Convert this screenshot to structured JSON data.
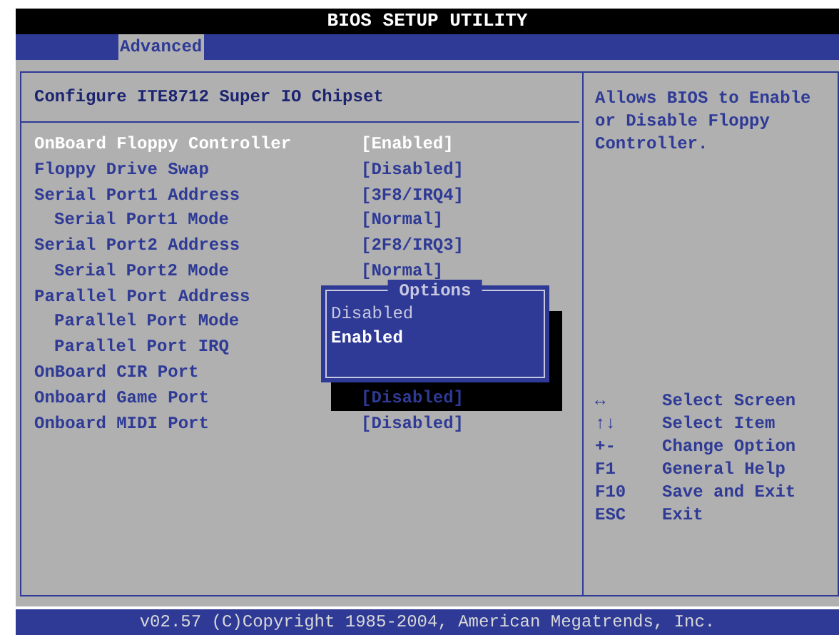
{
  "title": "BIOS SETUP UTILITY",
  "tabs": [
    {
      "label": "Advanced",
      "selected": true
    }
  ],
  "section_title": "Configure ITE8712 Super IO Chipset",
  "items": [
    {
      "label": "OnBoard Floppy Controller",
      "value": "[Enabled]",
      "selected": true
    },
    {
      "label": "Floppy Drive Swap",
      "value": "[Disabled]",
      "selected": false
    },
    {
      "label": "Serial Port1 Address",
      "value": "[3F8/IRQ4]",
      "selected": false,
      "children": [
        {
          "label": "Serial Port1 Mode",
          "value": "[Normal]",
          "selected": false
        }
      ]
    },
    {
      "label": "Serial Port2 Address",
      "value": "[2F8/IRQ3]",
      "selected": false,
      "children": [
        {
          "label": "Serial Port2 Mode",
          "value": "[Normal]",
          "selected": false
        }
      ]
    },
    {
      "label": "Parallel Port Address",
      "selected": false,
      "children": [
        {
          "label": "Parallel Port Mode",
          "selected": false
        },
        {
          "label": "Parallel Port IRQ",
          "selected": false
        }
      ]
    },
    {
      "label": "OnBoard CIR Port",
      "selected": false
    },
    {
      "label": "Onboard Game Port",
      "value": "[Disabled]",
      "selected": false
    },
    {
      "label": "Onboard MIDI Port",
      "value": "[Disabled]",
      "selected": false
    }
  ],
  "help_text": "Allows BIOS to Enable or Disable Floppy Controller.",
  "keys": [
    {
      "key": "↔",
      "action": "Select Screen"
    },
    {
      "key": "↑↓",
      "action": "Select Item"
    },
    {
      "key": "+-",
      "action": "Change Option"
    },
    {
      "key": "F1",
      "action": "General Help"
    },
    {
      "key": "F10",
      "action": "Save and Exit"
    },
    {
      "key": "ESC",
      "action": "Exit"
    }
  ],
  "popup": {
    "title": "Options",
    "options": [
      {
        "label": "Disabled",
        "selected": false
      },
      {
        "label": "Enabled",
        "selected": true
      }
    ]
  },
  "footer": "v02.57 (C)Copyright 1985-2004, American Megatrends, Inc."
}
